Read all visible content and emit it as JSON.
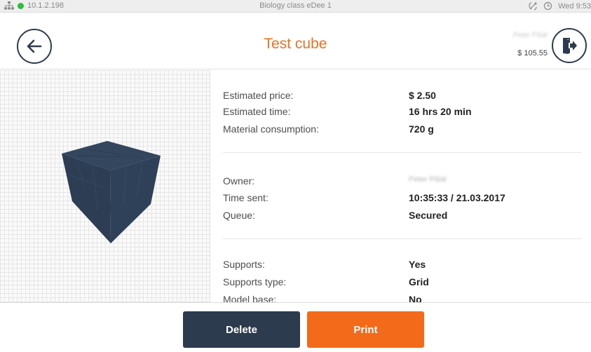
{
  "status_bar": {
    "ip": "10.1.2.198",
    "network_status_color": "#2fbd3a",
    "device_name": "Biology class eDee 1",
    "clock": "Wed 9:53",
    "icons": [
      "network-icon",
      "antenna-icon",
      "alarm-clock-icon"
    ]
  },
  "header": {
    "title": "Test cube",
    "user": {
      "name": "Peter Pišát",
      "balance": "$ 105.55"
    },
    "icons": [
      "back-arrow-icon",
      "logout-door-icon"
    ]
  },
  "details": {
    "estimated_price": {
      "label": "Estimated price:",
      "value": "$ 2.50"
    },
    "estimated_time": {
      "label": "Estimated time:",
      "value": "16 hrs 20 min"
    },
    "material": {
      "label": "Material consumption:",
      "value": "720 g"
    },
    "owner": {
      "label": "Owner:",
      "value": "Peter Pišát"
    },
    "time_sent": {
      "label": "Time sent:",
      "value": "10:35:33 / 21.03.2017"
    },
    "queue": {
      "label": "Queue:",
      "value": "Secured"
    },
    "supports": {
      "label": "Supports:",
      "value": "Yes"
    },
    "supports_type": {
      "label": "Supports type:",
      "value": "Grid"
    },
    "model_base": {
      "label": "Model base:",
      "value": "No"
    }
  },
  "footer": {
    "delete_label": "Delete",
    "print_label": "Print"
  },
  "colors": {
    "accent": "#f07023",
    "dark": "#2d3b4e",
    "print_button": "#f36a1a"
  }
}
